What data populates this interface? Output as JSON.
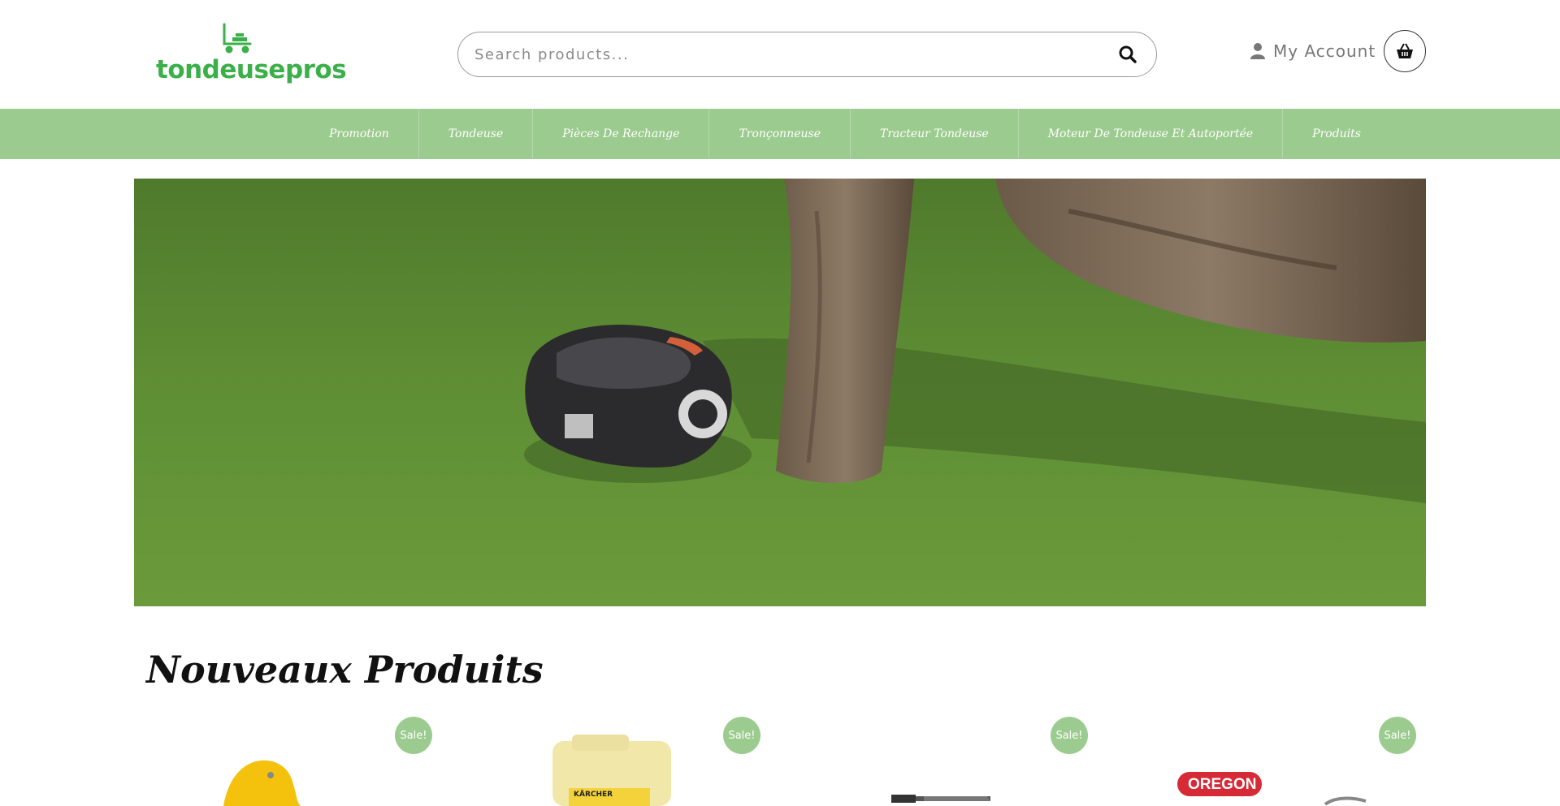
{
  "brand": {
    "name": "tondeusepros",
    "accent": "#3bb04a",
    "nav_color": "#9ccb8f"
  },
  "search": {
    "placeholder": "Search products..."
  },
  "account": {
    "label": "My Account"
  },
  "nav": {
    "items": [
      {
        "label": "Promotion"
      },
      {
        "label": "Tondeuse"
      },
      {
        "label": "Pièces De Rechange"
      },
      {
        "label": "Tronçonneuse"
      },
      {
        "label": "Tracteur Tondeuse"
      },
      {
        "label": "Moteur De Tondeuse Et Autoportée"
      },
      {
        "label": "Produits"
      }
    ]
  },
  "hero": {
    "image": "robotic-lawn-mower-under-tree"
  },
  "section": {
    "title": "Nouveaux Produits"
  },
  "products": [
    {
      "badge": "Sale!",
      "image": "yellow-hook-tool"
    },
    {
      "badge": "Sale!",
      "image": "karcher-detergent-can",
      "brand_text": "KÄRCHER"
    },
    {
      "badge": "Sale!",
      "image": "jigsaw-blade"
    },
    {
      "badge": "Sale!",
      "image": "oregon-chain-product",
      "brand_text": "OREGON"
    }
  ]
}
